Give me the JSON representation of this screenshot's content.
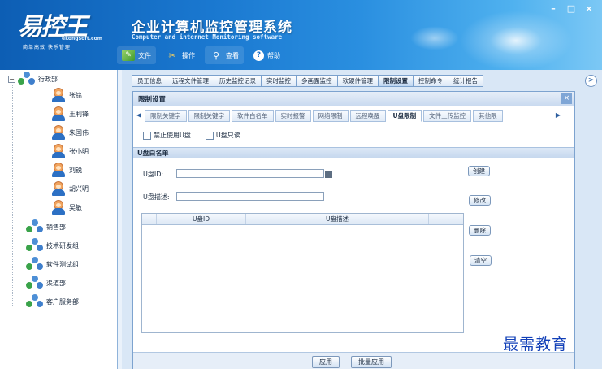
{
  "window": {
    "title": "企业计算机监控管理系统",
    "subtitle": "Computer and internet Monitoring software",
    "controls": [
      "–",
      "□",
      "×"
    ]
  },
  "logo": {
    "text": "易控王",
    "url": "ekongsoft.com",
    "slogan": "简单高效 快乐管理"
  },
  "toolbar": {
    "file": "文件",
    "operate": "操作",
    "view": "查看",
    "help": "帮助"
  },
  "tree": {
    "root": "行政部",
    "users": [
      "张铭",
      "王利锋",
      "朱国伟",
      "张小明",
      "刘锐",
      "胡兴明",
      "吴敏"
    ],
    "groups": [
      "销售部",
      "技术研发组",
      "软件测试组",
      "渠道部",
      "客户服务部"
    ]
  },
  "main_tabs": [
    "员工信息",
    "远程文件管理",
    "历史监控记录",
    "实时监控",
    "多画面监控",
    "软硬件管理",
    "限制设置",
    "控制命令",
    "统计报告"
  ],
  "main_tabs_active": "限制设置",
  "panel": {
    "title": "限制设置",
    "close": "×",
    "sub_tabs": [
      "限制关键字",
      "限制关键字",
      "软件白名单",
      "实时报警",
      "网络限制",
      "远程唤醒",
      "U盘限制",
      "文件上传监控",
      "其他限"
    ],
    "sub_tabs_active": "U盘限制",
    "checkbox_disable_usb": "禁止使用U盘",
    "checkbox_readonly": "U盘只读",
    "section_title": "U盘白名单",
    "usb_id_label": "U盘ID:",
    "usb_desc_label": "U盘描述:",
    "grid_col_id": "U盘ID",
    "grid_col_desc": "U盘描述",
    "btn_create": "创建",
    "btn_modify": "修改",
    "btn_delete": "删除",
    "btn_clear": "清空",
    "btn_apply": "应用",
    "btn_batch_apply": "批量应用"
  },
  "watermark": "最需教育"
}
